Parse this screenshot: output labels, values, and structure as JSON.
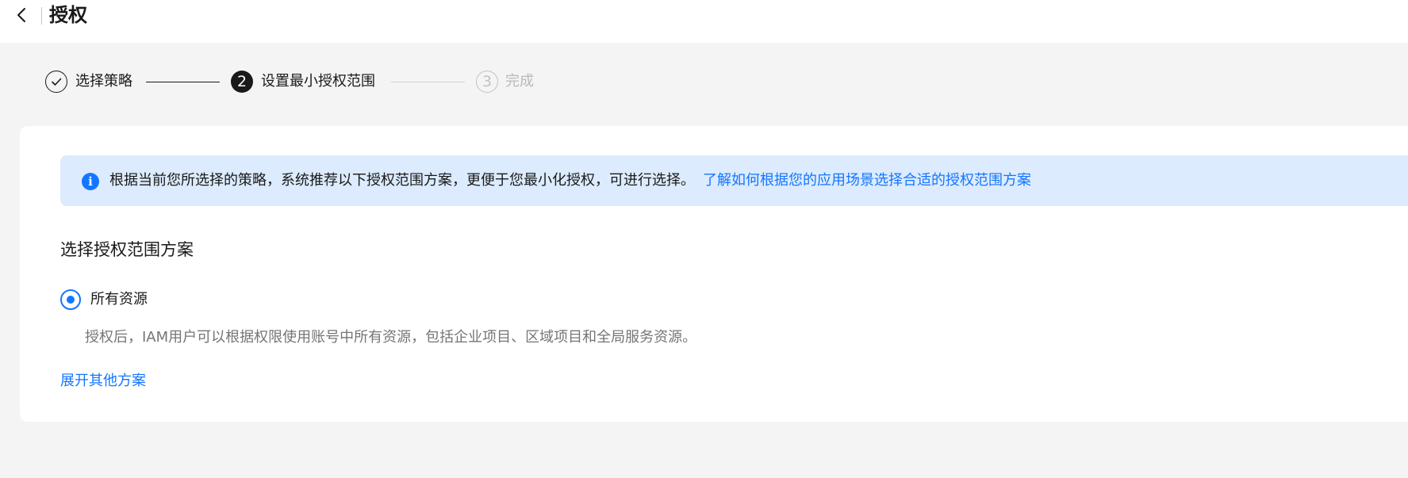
{
  "header": {
    "back_icon": "chevron-left-icon",
    "title": "授权"
  },
  "steps": [
    {
      "index": "1",
      "label": "选择策略",
      "status": "completed"
    },
    {
      "index": "2",
      "label": "设置最小授权范围",
      "status": "active"
    },
    {
      "index": "3",
      "label": "完成",
      "status": "pending"
    }
  ],
  "info_banner": {
    "icon": "info-icon",
    "text": "根据当前您所选择的策略，系统推荐以下授权范围方案，更便于您最小化授权，可进行选择。",
    "link": "了解如何根据您的应用场景选择合适的授权范围方案"
  },
  "scope": {
    "section_title": "选择授权范围方案",
    "option_label": "所有资源",
    "option_selected": true,
    "option_description": "授权后，IAM用户可以根据权限使用账号中所有资源，包括企业项目、区域项目和全局服务资源。",
    "expand_link": "展开其他方案"
  },
  "colors": {
    "accent": "#1476ff",
    "banner_bg": "#dcebfd",
    "page_bg": "#f4f4f4"
  }
}
